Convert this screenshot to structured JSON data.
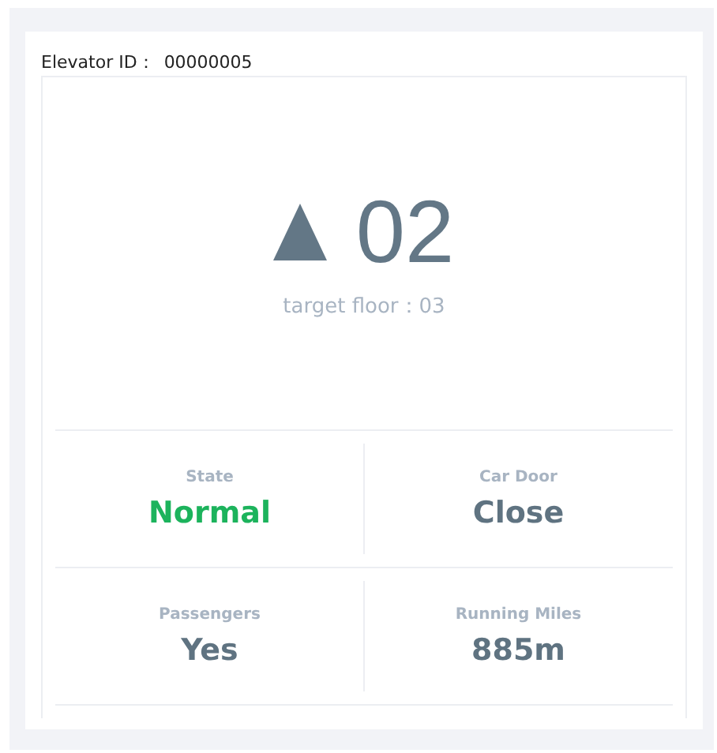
{
  "card": {
    "label": "Elevator ID：",
    "value": "00000005"
  },
  "floor": {
    "moving_up": true,
    "current": "02",
    "target": "target floor：03"
  },
  "stats": [
    {
      "label": "State",
      "value": "Normal",
      "color": "#1cb35c"
    },
    {
      "label": "Car Door",
      "value": "Close",
      "color": "#5f7381"
    },
    {
      "label": "Passengers",
      "value": "Yes",
      "color": "#5f7381"
    },
    {
      "label": "Running Miles",
      "value": "885m",
      "color": "#5f7381"
    }
  ]
}
